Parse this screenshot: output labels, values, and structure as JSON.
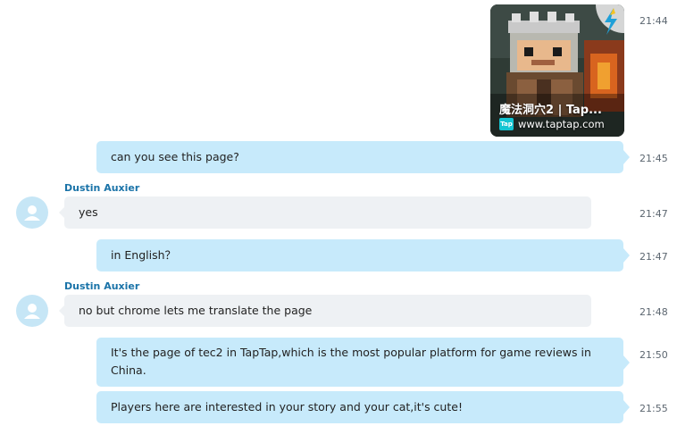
{
  "colors": {
    "outgoing_bubble": "#c7eafb",
    "incoming_bubble": "#eef1f4",
    "sender_name": "#1a73a8",
    "avatar_bg": "#c6e6f6",
    "tap_badge": "#14c5d2"
  },
  "link_card": {
    "title": "魔法洞穴2 | Tap...",
    "badge": "Tap",
    "domain": "www.taptap.com",
    "time": "21:44",
    "icons": [
      "pixel-game-art",
      "lightning-bolt-logo-icon",
      "tap-badge-icon"
    ]
  },
  "messages": [
    {
      "text": "can you see this page?",
      "time": "21:45"
    },
    {
      "sender": "Dustin Auxier",
      "text": "yes",
      "time": "21:47",
      "avatar_icon": "person-avatar-icon"
    },
    {
      "text": "in English？",
      "time": "21:47"
    },
    {
      "sender": "Dustin Auxier",
      "text": "no but chrome lets me translate the page",
      "time": "21:48",
      "avatar_icon": "person-avatar-icon"
    },
    {
      "text": "It's the page of tec2 in TapTap,which is the most popular platform for game reviews in China.",
      "time": "21:50"
    },
    {
      "text": "Players here are interested in your story and your cat,it's cute!",
      "time": "21:55"
    }
  ]
}
